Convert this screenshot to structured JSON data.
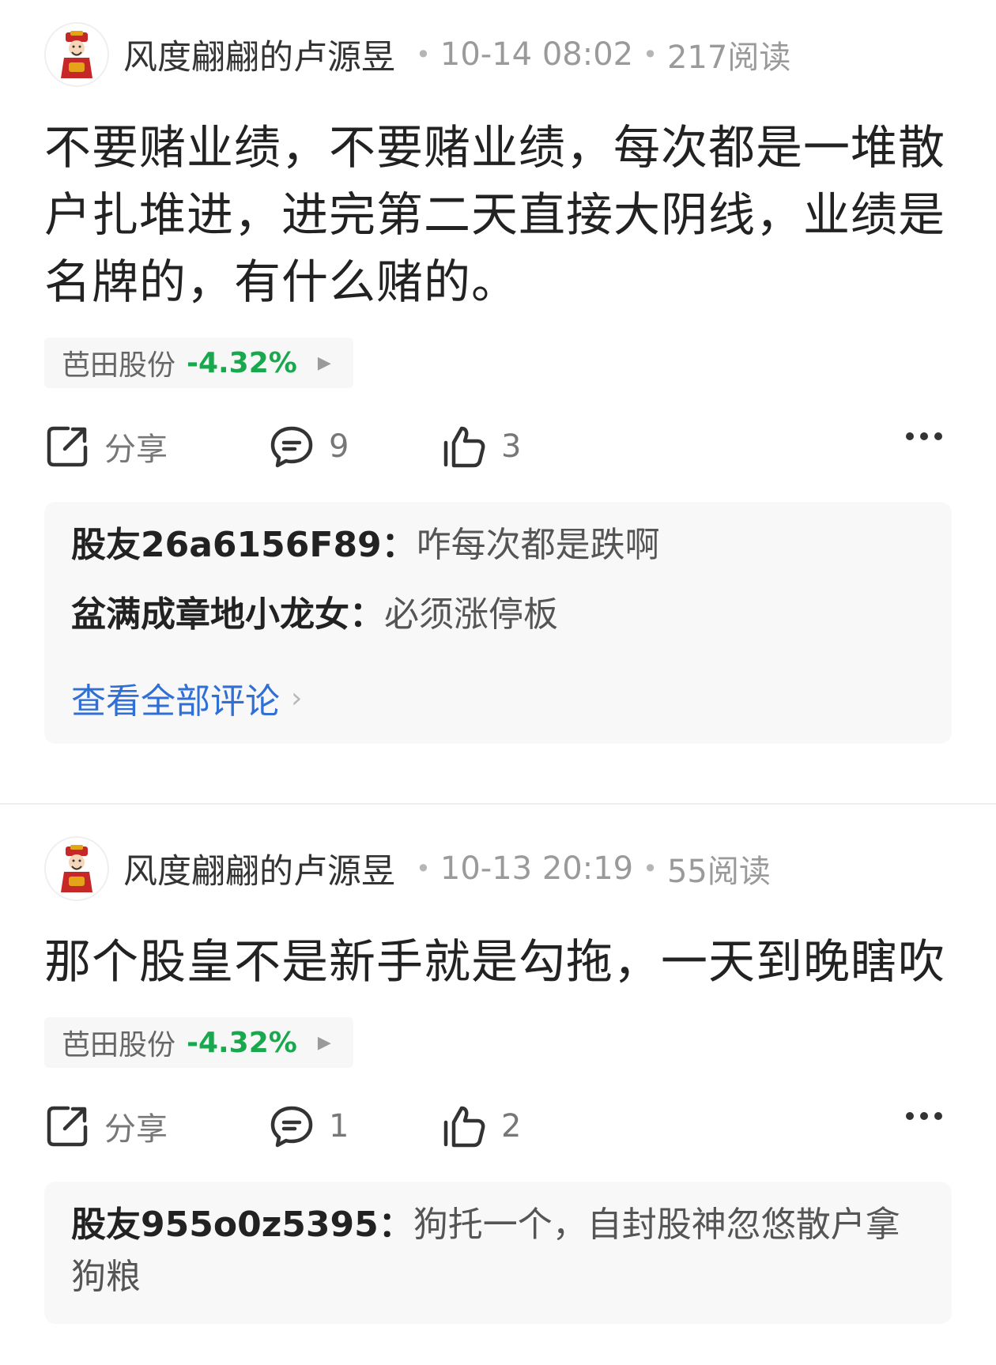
{
  "colors": {
    "accent_link": "#2f6fd6",
    "stock_down": "#19a84d"
  },
  "posts": [
    {
      "author": "风度翩翩的卢源昱",
      "time": "10-14 08:02",
      "reads": "217阅读",
      "avatar_icon": "god-of-wealth-avatar",
      "text": "不要赌业绩，不要赌业绩，每次都是一堆散户扎堆进，进完第二天直接大阴线，业绩是名牌的，有什么赌的。",
      "stock": {
        "name": "芭田股份",
        "change": "-4.32%"
      },
      "share_label": "分享",
      "comment_count": "9",
      "like_count": "3",
      "comments": [
        {
          "user": "股友26a6156F89：",
          "text": "咋每次都是跌啊"
        },
        {
          "user": "盆满成章地小龙女：",
          "text": "必须涨停板"
        }
      ],
      "view_all": "查看全部评论"
    },
    {
      "author": "风度翩翩的卢源昱",
      "time": "10-13 20:19",
      "reads": "55阅读",
      "avatar_icon": "god-of-wealth-avatar",
      "text": "那个股皇不是新手就是勾拖，一天到晚瞎吹",
      "stock": {
        "name": "芭田股份",
        "change": "-4.32%"
      },
      "share_label": "分享",
      "comment_count": "1",
      "like_count": "2",
      "comments": [
        {
          "user": "股友955o0z5395：",
          "text": "狗托一个，自封股神忽悠散户拿狗粮"
        }
      ]
    }
  ]
}
